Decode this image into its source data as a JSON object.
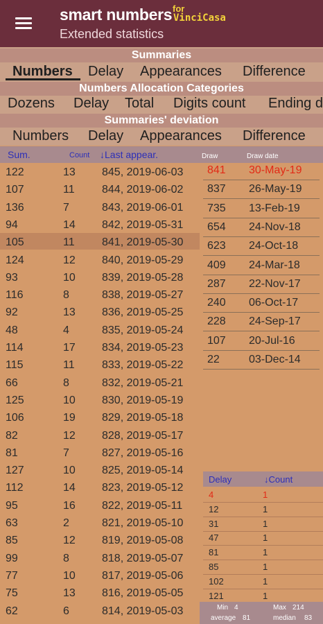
{
  "app": {
    "title": "smart numbers",
    "for": "for",
    "brand": "VinciCasa",
    "subtitle": "Extended statistics"
  },
  "summaries": {
    "title": "Summaries",
    "tabs": [
      "Numbers",
      "Delay",
      "Appearances",
      "Difference"
    ]
  },
  "allocation": {
    "title": "Numbers Allocation Categories",
    "tabs": [
      "Dozens",
      "Delay",
      "Total",
      "Digits count",
      "Ending d"
    ]
  },
  "deviation": {
    "title": "Summaries' deviation",
    "tabs": [
      "Numbers",
      "Delay",
      "Appearances",
      "Difference"
    ]
  },
  "left_table": {
    "headers": {
      "sum": "Sum.",
      "count": "Count",
      "last": "↓Last appear."
    },
    "rows": [
      {
        "sum": "122",
        "count": "13",
        "last": "845, 2019-06-03"
      },
      {
        "sum": "107",
        "count": "11",
        "last": "844, 2019-06-02"
      },
      {
        "sum": "136",
        "count": "7",
        "last": "843, 2019-06-01"
      },
      {
        "sum": "94",
        "count": "14",
        "last": "842, 2019-05-31"
      },
      {
        "sum": "105",
        "count": "11",
        "last": "841, 2019-05-30"
      },
      {
        "sum": "124",
        "count": "12",
        "last": "840, 2019-05-29"
      },
      {
        "sum": "93",
        "count": "10",
        "last": "839, 2019-05-28"
      },
      {
        "sum": "116",
        "count": "8",
        "last": "838, 2019-05-27"
      },
      {
        "sum": "92",
        "count": "13",
        "last": "836, 2019-05-25"
      },
      {
        "sum": "48",
        "count": "4",
        "last": "835, 2019-05-24"
      },
      {
        "sum": "114",
        "count": "17",
        "last": "834, 2019-05-23"
      },
      {
        "sum": "115",
        "count": "11",
        "last": "833, 2019-05-22"
      },
      {
        "sum": "66",
        "count": "8",
        "last": "832, 2019-05-21"
      },
      {
        "sum": "125",
        "count": "10",
        "last": "830, 2019-05-19"
      },
      {
        "sum": "106",
        "count": "19",
        "last": "829, 2019-05-18"
      },
      {
        "sum": "82",
        "count": "12",
        "last": "828, 2019-05-17"
      },
      {
        "sum": "81",
        "count": "7",
        "last": "827, 2019-05-16"
      },
      {
        "sum": "127",
        "count": "10",
        "last": "825, 2019-05-14"
      },
      {
        "sum": "112",
        "count": "14",
        "last": "823, 2019-05-12"
      },
      {
        "sum": "95",
        "count": "16",
        "last": "822, 2019-05-11"
      },
      {
        "sum": "63",
        "count": "2",
        "last": "821, 2019-05-10"
      },
      {
        "sum": "85",
        "count": "12",
        "last": "819, 2019-05-08"
      },
      {
        "sum": "99",
        "count": "8",
        "last": "818, 2019-05-07"
      },
      {
        "sum": "77",
        "count": "10",
        "last": "817, 2019-05-06"
      },
      {
        "sum": "75",
        "count": "13",
        "last": "816, 2019-05-05"
      },
      {
        "sum": "62",
        "count": "6",
        "last": "814, 2019-05-03"
      }
    ]
  },
  "draw_table": {
    "headers": {
      "draw": "Draw",
      "date": "Draw date"
    },
    "rows": [
      {
        "draw": "841",
        "date": "30-May-19"
      },
      {
        "draw": "837",
        "date": "26-May-19"
      },
      {
        "draw": "735",
        "date": "13-Feb-19"
      },
      {
        "draw": "654",
        "date": "24-Nov-18"
      },
      {
        "draw": "623",
        "date": "24-Oct-18"
      },
      {
        "draw": "409",
        "date": "24-Mar-18"
      },
      {
        "draw": "287",
        "date": "22-Nov-17"
      },
      {
        "draw": "240",
        "date": "06-Oct-17"
      },
      {
        "draw": "228",
        "date": "24-Sep-17"
      },
      {
        "draw": "107",
        "date": "20-Jul-16"
      },
      {
        "draw": "22",
        "date": "03-Dec-14"
      }
    ]
  },
  "delay_table": {
    "headers": {
      "delay": "Delay",
      "count": "↓Count"
    },
    "rows": [
      {
        "delay": "4",
        "count": "1"
      },
      {
        "delay": "12",
        "count": "1"
      },
      {
        "delay": "31",
        "count": "1"
      },
      {
        "delay": "47",
        "count": "1"
      },
      {
        "delay": "81",
        "count": "1"
      },
      {
        "delay": "85",
        "count": "1"
      },
      {
        "delay": "102",
        "count": "1"
      },
      {
        "delay": "121",
        "count": "1"
      }
    ]
  },
  "stats": {
    "min_label": "Min",
    "min": "4",
    "max_label": "Max",
    "max": "214",
    "avg_label": "average",
    "avg": "81",
    "median_label": "median",
    "median": "83"
  },
  "colors": {
    "appbar": "#6b2e3c",
    "brand_yellow": "#f3d23a",
    "highlight_red": "#e22a16",
    "link_blue": "#2c2fb8",
    "background": "#d49a6a"
  }
}
